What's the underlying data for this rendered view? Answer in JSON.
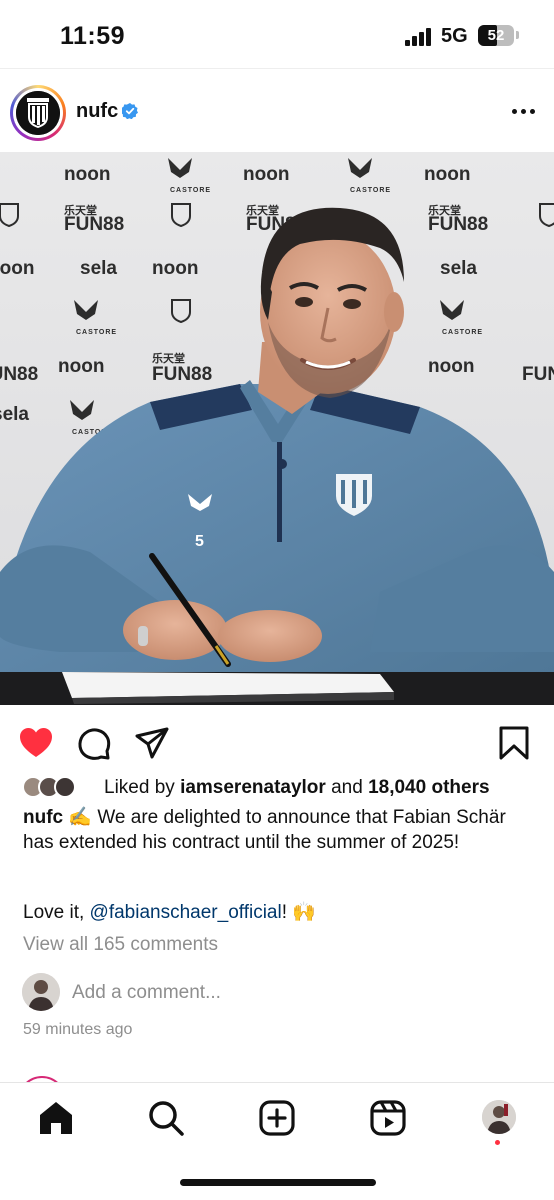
{
  "status_bar": {
    "time": "11:59",
    "network": "5G",
    "battery": "52",
    "battery_fraction": 0.52
  },
  "post": {
    "username": "nufc",
    "verified_icon": "verified-badge-icon",
    "more_icon": "more-options-icon",
    "photo_icon": "photo-contract-signing",
    "photo_sponsor_text": [
      "noon",
      "CASTORE",
      "FUN88",
      "sela",
      "乐天堂"
    ],
    "shirt_number": "5",
    "actions": {
      "like_icon": "heart-filled-icon",
      "comment_icon": "comment-icon",
      "share_icon": "share-icon",
      "save_icon": "bookmark-icon"
    },
    "likes": {
      "prefix": "Liked by",
      "liker": "iamserenataylor",
      "joiner": "and",
      "others": "18,040 others"
    },
    "caption": {
      "username": "nufc",
      "emoji": "✍",
      "text": "We are delighted to announce that Fabian Schär has extended his contract until the summer of 2025!",
      "line2_prefix": "Love it,",
      "mention": "@fabianschaer_official",
      "line2_suffix": "!",
      "line2_emoji": "🙌"
    },
    "view_comments": "View all 165 comments",
    "add_comment_placeholder": "Add a comment...",
    "timestamp": "59 minutes ago"
  },
  "bottom_nav": {
    "home_icon": "home-icon",
    "search_icon": "search-icon",
    "create_icon": "create-post-icon",
    "reels_icon": "reels-icon",
    "profile_icon": "profile-avatar"
  },
  "colors": {
    "like_red": "#ff3040",
    "mention_blue": "#00376b",
    "verified_blue": "#3897f0",
    "muted_grey": "#8e8e8e",
    "backdrop": "#e4e4e4",
    "tracksuit": "#5f89ad"
  }
}
